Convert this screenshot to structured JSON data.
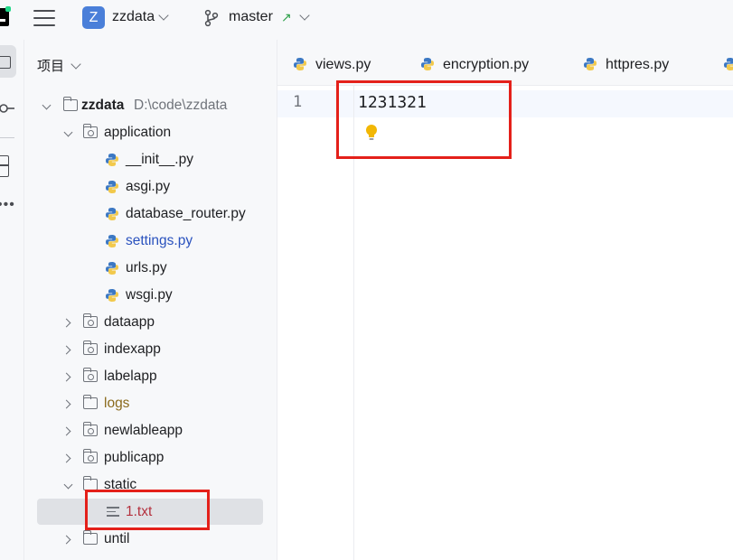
{
  "header": {
    "project_badge": "Z",
    "project_name": "zzdata",
    "branch_name": "master",
    "branch_arrow": "↗"
  },
  "panel": {
    "title": "项目"
  },
  "tree": {
    "root": {
      "name": "zzdata",
      "path": "D:\\code\\zzdata"
    },
    "application": "application",
    "files": [
      "__init__.py",
      "asgi.py",
      "database_router.py",
      "settings.py",
      "urls.py",
      "wsgi.py"
    ],
    "dataapp": "dataapp",
    "indexapp": "indexapp",
    "labelapp": "labelapp",
    "logs": "logs",
    "newlableapp": "newlableapp",
    "publicapp": "publicapp",
    "static": "static",
    "txt_file": "1.txt",
    "until": "until"
  },
  "tabs": [
    "views.py",
    "encryption.py",
    "httpres.py"
  ],
  "editor": {
    "line_number": "1",
    "code": "1231321"
  },
  "colors": {
    "accent": "#4a7fd9",
    "highlight_box": "#e4201a",
    "modified_file": "#2a52be",
    "excluded_folder": "#8a6a1c",
    "ignored_file": "#b4313e"
  }
}
